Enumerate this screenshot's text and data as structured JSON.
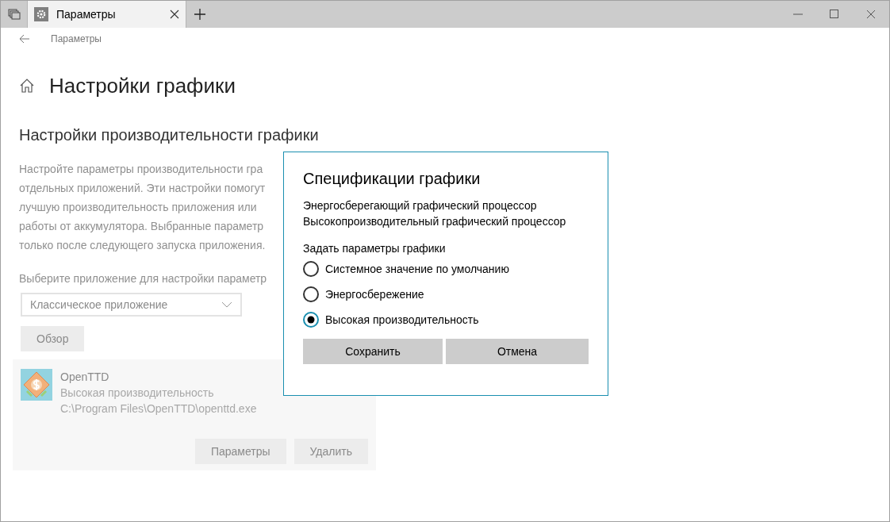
{
  "tabs": [
    {
      "label": "Параметры",
      "selected": true
    }
  ],
  "breadcrumb": "Параметры",
  "page_title": "Настройки графики",
  "section_title": "Настройки производительности графики",
  "description_lines": [
    "Настройте параметры производительности гра",
    "отдельных приложений. Эти настройки помогут",
    "лучшую производительность приложения или",
    "работы от аккумулятора. Выбранные параметр",
    "только после следующего запуска приложения."
  ],
  "app_picker": {
    "label": "Выберите приложение для настройки параметр",
    "value": "Классическое приложение",
    "browse_button": "Обзор"
  },
  "apps": [
    {
      "name": "OpenTTD",
      "preference": "Высокая производительность",
      "path": "C:\\Program Files\\OpenTTD\\openttd.exe",
      "buttons": [
        "Параметры",
        "Удалить"
      ]
    }
  ],
  "dialog": {
    "title": "Спецификации графики",
    "gpus": [
      "Энергосберегающий графический процессор",
      "Высокопроизводительный графический процессор"
    ],
    "prompt": "Задать параметры графики",
    "options": [
      {
        "label": "Системное значение по умолчанию",
        "selected": false
      },
      {
        "label": "Энергосбережение",
        "selected": false
      },
      {
        "label": "Высокая производительность",
        "selected": true
      }
    ],
    "buttons": [
      "Сохранить",
      "Отмена"
    ]
  }
}
